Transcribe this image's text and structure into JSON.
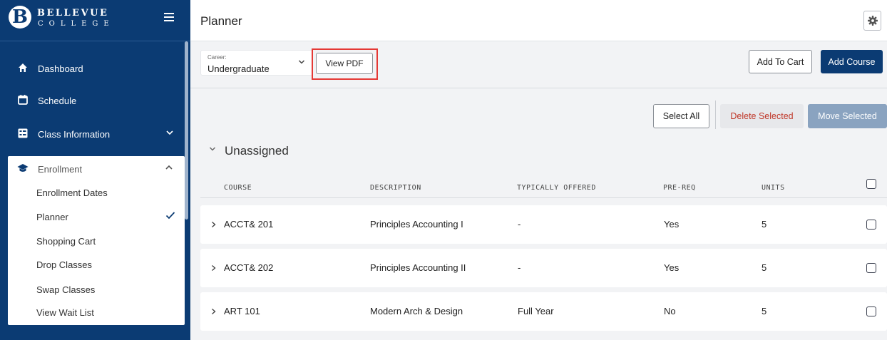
{
  "brand": {
    "name_top": "BELLEVUE",
    "name_bottom": "COLLEGE",
    "initial": "B"
  },
  "sidebar": {
    "items": [
      {
        "label": "Dashboard"
      },
      {
        "label": "Schedule"
      },
      {
        "label": "Class Information"
      },
      {
        "label": "Enrollment"
      }
    ],
    "enrollment_items": [
      {
        "label": "Enrollment Dates"
      },
      {
        "label": "Planner"
      },
      {
        "label": "Shopping Cart"
      },
      {
        "label": "Drop Classes"
      },
      {
        "label": "Swap Classes"
      },
      {
        "label": "View Wait List"
      }
    ]
  },
  "header": {
    "title": "Planner"
  },
  "toolbar": {
    "career_caption": "Career:",
    "career_value": "Undergraduate",
    "view_pdf_label": "View PDF",
    "add_to_cart_label": "Add To Cart",
    "add_course_label": "Add Course",
    "select_all_label": "Select All",
    "delete_selected_label": "Delete Selected",
    "move_selected_label": "Move Selected"
  },
  "section": {
    "title": "Unassigned"
  },
  "table": {
    "columns": [
      "COURSE",
      "DESCRIPTION",
      "TYPICALLY OFFERED",
      "PRE-REQ",
      "UNITS"
    ],
    "rows": [
      {
        "course": "ACCT& 201",
        "description": "Principles Accounting I",
        "offered": "-",
        "prereq": "Yes",
        "units": "5"
      },
      {
        "course": "ACCT& 202",
        "description": "Principles Accounting II",
        "offered": "-",
        "prereq": "Yes",
        "units": "5"
      },
      {
        "course": "ART 101",
        "description": "Modern Arch & Design",
        "offered": "Full Year",
        "prereq": "No",
        "units": "5"
      }
    ]
  },
  "colors": {
    "sidebar": "#0b3b73",
    "primary": "#0b3b73",
    "danger_text": "#c0392b",
    "highlight": "#e53935"
  }
}
